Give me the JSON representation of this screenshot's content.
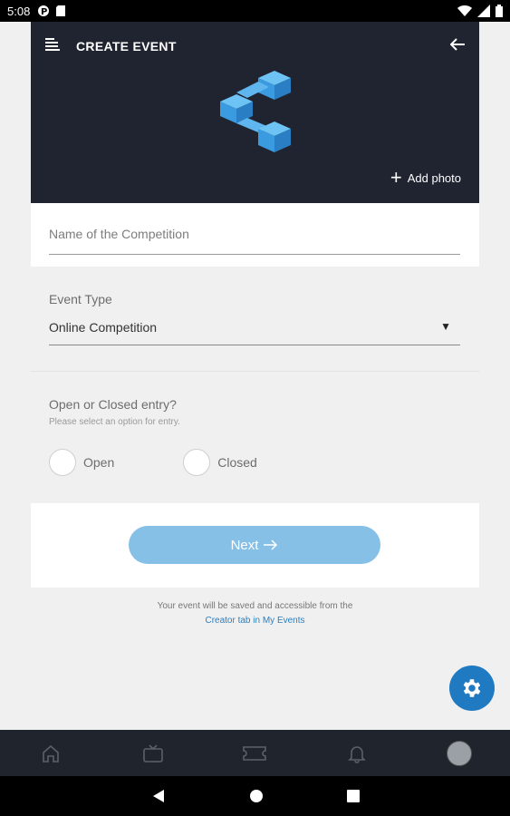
{
  "status_bar": {
    "time": "5:08"
  },
  "header": {
    "title": "CREATE EVENT",
    "add_photo_label": "Add photo"
  },
  "form": {
    "name_placeholder": "Name of the Competition",
    "event_type_label": "Event Type",
    "event_type_value": "Online Competition",
    "entry_question": "Open or Closed entry?",
    "entry_helper": "Please select an option for entry.",
    "entry_options": [
      "Open",
      "Closed"
    ],
    "next_label": "Next"
  },
  "footer": {
    "line1": "Your event will be saved and accessible from the",
    "link": "Creator tab in My Events"
  },
  "colors": {
    "header_bg": "#1f2430",
    "accent": "#1f7ac2",
    "next_button": "#87c0e6",
    "link": "#2c7fbd"
  },
  "icons": {
    "bottom_nav": [
      "home-icon",
      "tv-icon",
      "ticket-icon",
      "bell-icon",
      "profile-avatar"
    ]
  }
}
